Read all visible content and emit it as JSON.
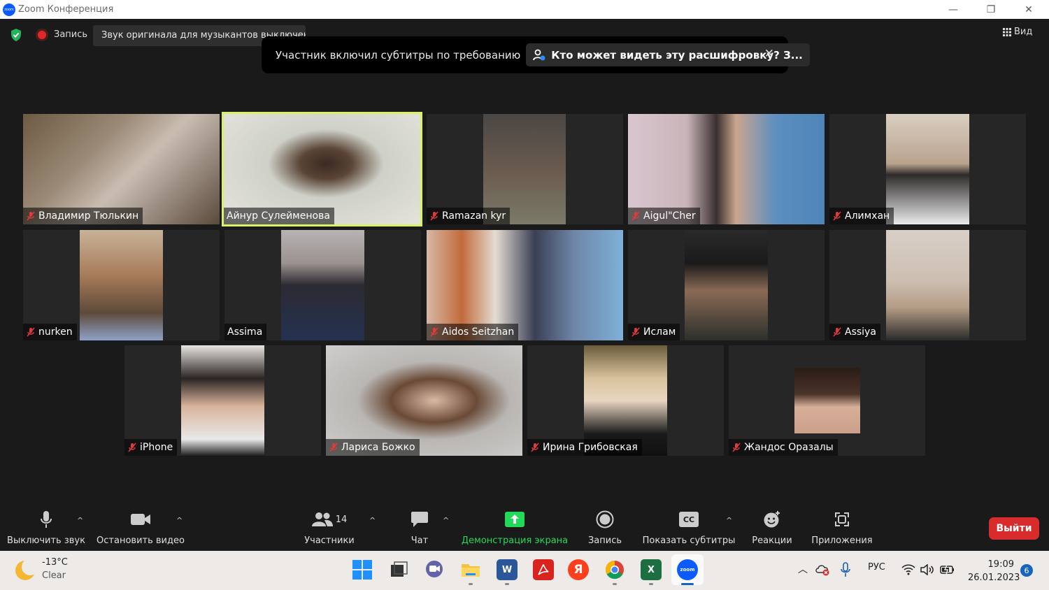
{
  "window": {
    "title": "Zoom Конференция",
    "minimize": "—",
    "restore": "❐",
    "close": "✕"
  },
  "top_bar": {
    "recording_label": "Запись",
    "original_sound_text": "Звук оригинала для музыкантов выключен",
    "view_label": "Вид"
  },
  "notification": {
    "message": "Участник включил субтитры по требованию",
    "who_can_see": "Кто может видеть эту расшифровку? З...",
    "close": "✕"
  },
  "participants": [
    {
      "name": "Владимир Тюлькин",
      "muted": true,
      "active": false
    },
    {
      "name": "Айнур Сулейменова",
      "muted": false,
      "active": true
    },
    {
      "name": "Ramazan kyr",
      "muted": true,
      "active": false
    },
    {
      "name": "Aigul\"Cher",
      "muted": true,
      "active": false
    },
    {
      "name": "Алимхан",
      "muted": true,
      "active": false
    },
    {
      "name": "nurken",
      "muted": true,
      "active": false
    },
    {
      "name": "Assima",
      "muted": false,
      "active": false
    },
    {
      "name": "Aidos Seitzhan",
      "muted": true,
      "active": false
    },
    {
      "name": "Ислам",
      "muted": true,
      "active": false
    },
    {
      "name": "Assiya",
      "muted": true,
      "active": false
    },
    {
      "name": "iPhone",
      "muted": true,
      "active": false
    },
    {
      "name": "Лариса Божко",
      "muted": true,
      "active": false
    },
    {
      "name": "Ирина Грибовская",
      "muted": true,
      "active": false
    },
    {
      "name": "Жандос Оразалы",
      "muted": true,
      "active": false
    }
  ],
  "toolbar": {
    "mute": "Выключить звук",
    "video": "Остановить видео",
    "participants": "Участники",
    "participants_count": "14",
    "chat": "Чат",
    "share": "Демонстрация экрана",
    "record": "Запись",
    "captions": "Показать субтитры",
    "captions_icon": "CC",
    "reactions": "Реакции",
    "apps": "Приложения",
    "leave": "Выйти",
    "caret": "^"
  },
  "taskbar": {
    "temperature": "-13°C",
    "condition": "Clear",
    "language": "РУС",
    "time": "19:09",
    "date": "26.01.2023",
    "notifications": "6",
    "word_icon": "W",
    "yandex_icon": "Я",
    "excel_icon": "X",
    "zoom_icon": "zoom"
  },
  "colors": {
    "accent_green": "#23d959",
    "leave_red": "#d82b2b",
    "active_speaker": "#d8f06a",
    "zoom_blue": "#0b5cff"
  }
}
